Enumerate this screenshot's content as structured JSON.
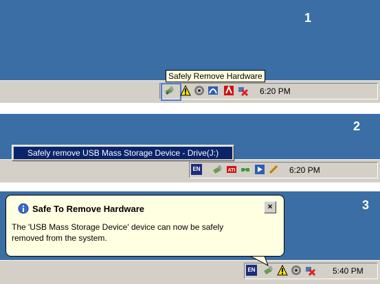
{
  "panel1": {
    "step": "1",
    "tooltip": "Safely Remove Hardware",
    "clock": "6:20 PM",
    "tray_icons": [
      "usb-hardware-icon",
      "warning-icon",
      "volume-icon",
      "network-icon",
      "ati-icon",
      "disconnected-network-icon"
    ]
  },
  "panel2": {
    "step": "2",
    "menu_item": "Safely remove USB Mass Storage Device - Drive(J:)",
    "language": "EN",
    "clock": "6:20 PM",
    "tray_icons": [
      "usb-hardware-icon",
      "ati-icon",
      "network-icon",
      "media-play-icon",
      "tool-icon"
    ]
  },
  "panel3": {
    "step": "3",
    "balloon": {
      "title": "Safe To Remove Hardware",
      "message": "The 'USB Mass Storage Device' device can now be safely removed from the system.",
      "close": "×"
    },
    "language": "EN",
    "clock": "5:40 PM",
    "tray_icons": [
      "usb-hardware-icon",
      "warning-icon",
      "volume-icon",
      "disconnected-network-icon"
    ]
  },
  "colors": {
    "desktop": "#3a6ea5",
    "taskbar": "#d4d0c8",
    "tooltip": "#ffffe1",
    "menu_highlight": "#0a246a"
  }
}
